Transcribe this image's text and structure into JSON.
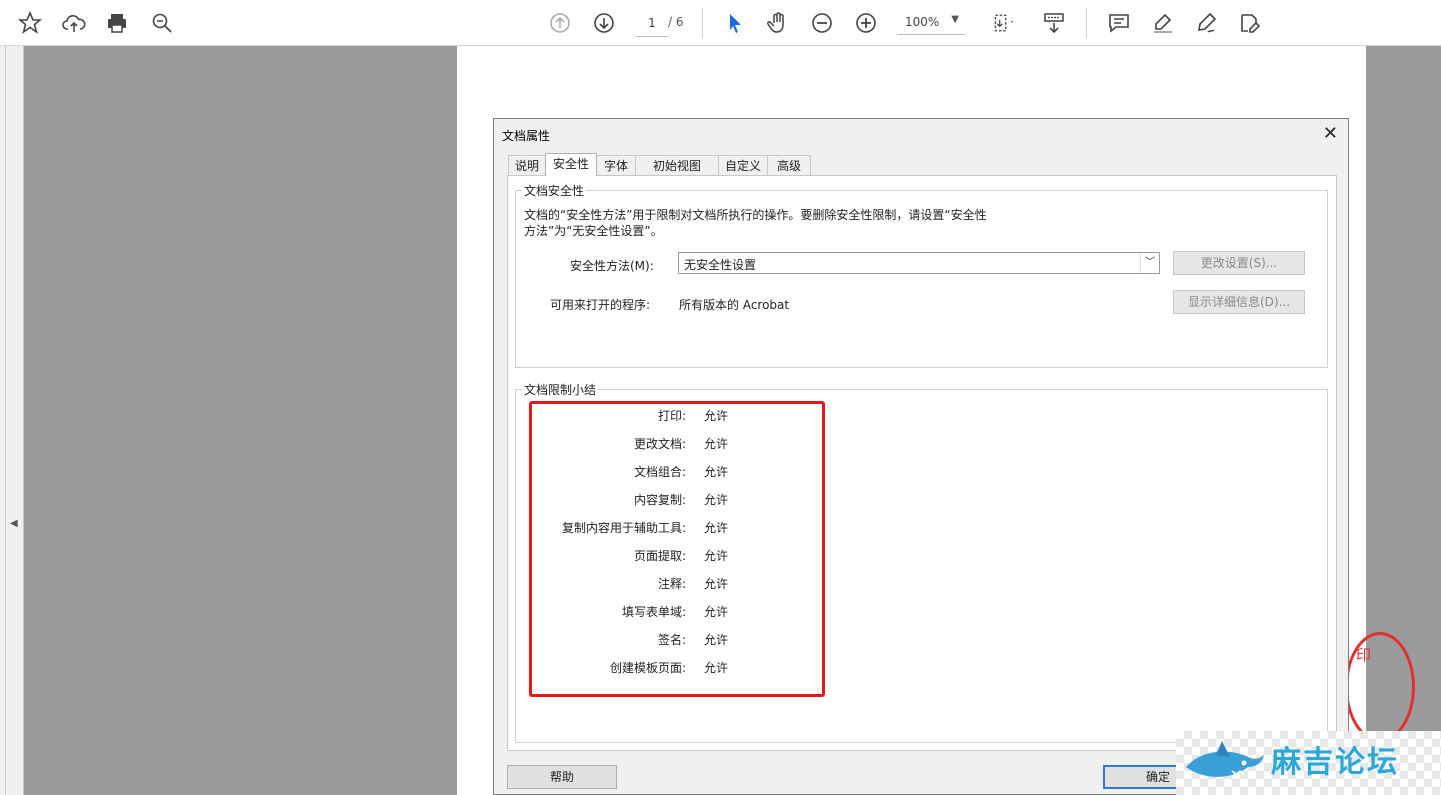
{
  "toolbar": {
    "page_current": "1",
    "page_total": "/ 6",
    "zoom": "100%"
  },
  "dialog": {
    "title": "文档属性",
    "tabs": [
      "说明",
      "安全性",
      "字体",
      "初始视图",
      "自定义",
      "高级"
    ],
    "active_tab": "安全性",
    "security_group": {
      "legend": "文档安全性",
      "description_line1": "文档的“安全性方法”用于限制对文档所执行的操作。要删除安全性限制，请设置“安全性",
      "description_line2": "方法”为“无安全性设置”。",
      "method_label": "安全性方法(M):",
      "method_value": "无安全性设置",
      "change_button": "更改设置(S)...",
      "open_label": "可用来打开的程序:",
      "open_value": "所有版本的 Acrobat",
      "details_button": "显示详细信息(D)..."
    },
    "restrictions_group": {
      "legend": "文档限制小结",
      "rows": [
        {
          "label": "打印:",
          "value": "允许"
        },
        {
          "label": "更改文档:",
          "value": "允许"
        },
        {
          "label": "文档组合:",
          "value": "允许"
        },
        {
          "label": "内容复制:",
          "value": "允许"
        },
        {
          "label": "复制内容用于辅助工具:",
          "value": "允许"
        },
        {
          "label": "页面提取:",
          "value": "允许"
        },
        {
          "label": "注释:",
          "value": "允许"
        },
        {
          "label": "填写表单域:",
          "value": "允许"
        },
        {
          "label": "签名:",
          "value": "允许"
        },
        {
          "label": "创建模板页面:",
          "value": "允许"
        }
      ]
    },
    "help_button": "帮助",
    "ok_button": "确定"
  },
  "stamp_text": "印",
  "watermark": "麻吉论坛",
  "colors": {
    "highlight": "#e31a1a",
    "accent": "#2f7ad2"
  }
}
